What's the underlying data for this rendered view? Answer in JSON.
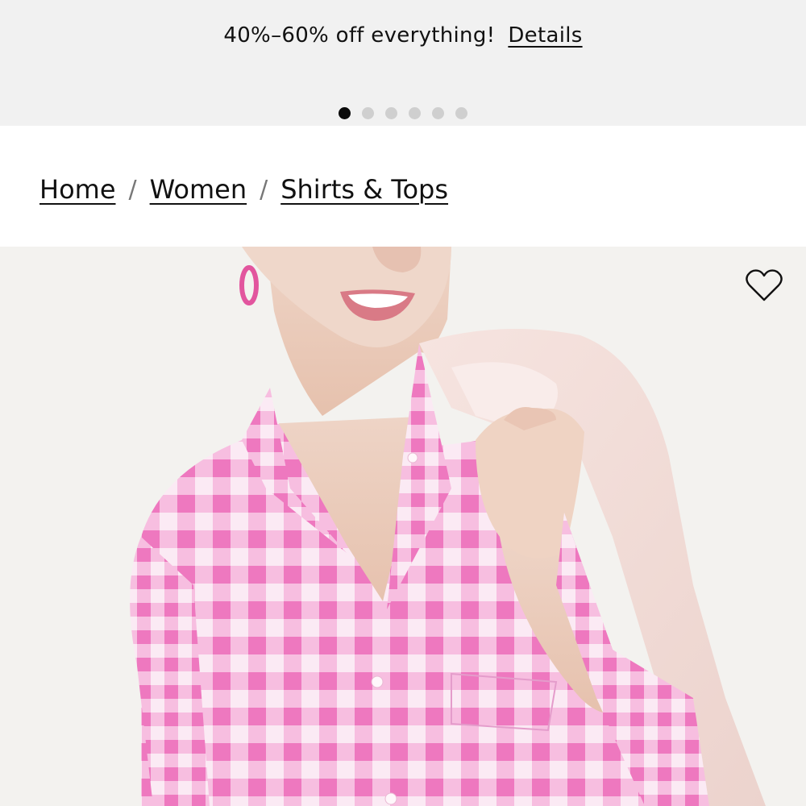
{
  "promo": {
    "message": "40%–60% off everything!",
    "details_label": "Details",
    "dots": [
      true,
      false,
      false,
      false,
      false,
      false
    ]
  },
  "breadcrumb": {
    "items": [
      "Home",
      "Women",
      "Shirts & Tops"
    ],
    "separator": "/"
  },
  "product": {
    "wishlist_icon": "heart-outline-icon",
    "shirt_colors": [
      "#f27fc4",
      "#f9c9e6",
      "#fbeaf4"
    ]
  }
}
